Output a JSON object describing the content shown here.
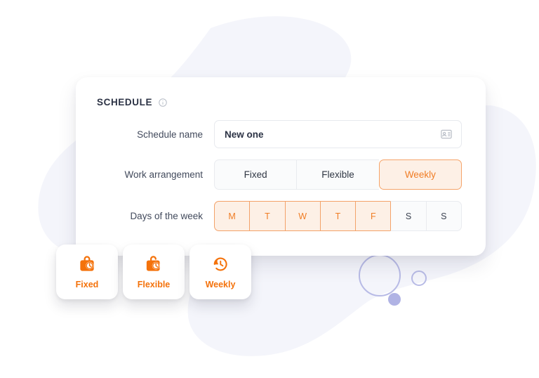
{
  "card": {
    "title": "SCHEDULE",
    "info_icon": "info-circle-icon"
  },
  "form": {
    "schedule_name": {
      "label": "Schedule name",
      "value": "New one",
      "placeholder": "Schedule name",
      "trailing_icon": "contact-card-icon"
    },
    "work_arrangement": {
      "label": "Work arrangement",
      "options": [
        {
          "label": "Fixed",
          "selected": false
        },
        {
          "label": "Flexible",
          "selected": false
        },
        {
          "label": "Weekly",
          "selected": true
        }
      ]
    },
    "days_of_week": {
      "label": "Days of the week",
      "options": [
        {
          "label": "M",
          "selected": true
        },
        {
          "label": "T",
          "selected": true
        },
        {
          "label": "W",
          "selected": true
        },
        {
          "label": "T",
          "selected": true
        },
        {
          "label": "F",
          "selected": true
        },
        {
          "label": "S",
          "selected": false
        },
        {
          "label": "S",
          "selected": false
        }
      ]
    }
  },
  "mini_cards": [
    {
      "label": "Fixed",
      "icon": "briefcase-clock-icon"
    },
    {
      "label": "Flexible",
      "icon": "open-briefcase-clock-icon"
    },
    {
      "label": "Weekly",
      "icon": "clock-rotate-left-icon"
    }
  ],
  "colors": {
    "accent": "#F4720B",
    "accent_soft": "#FDF0E6",
    "accent_border": "#F3A269",
    "text_dark": "#2C3345",
    "text_muted": "#424A5C",
    "surface": "#FFFFFF",
    "field_bg": "#FAFBFC",
    "field_border": "#E9EBEF",
    "blob": "#F4F5FB",
    "ring": "#B8BBE6",
    "dot": "#B0B3E4"
  }
}
